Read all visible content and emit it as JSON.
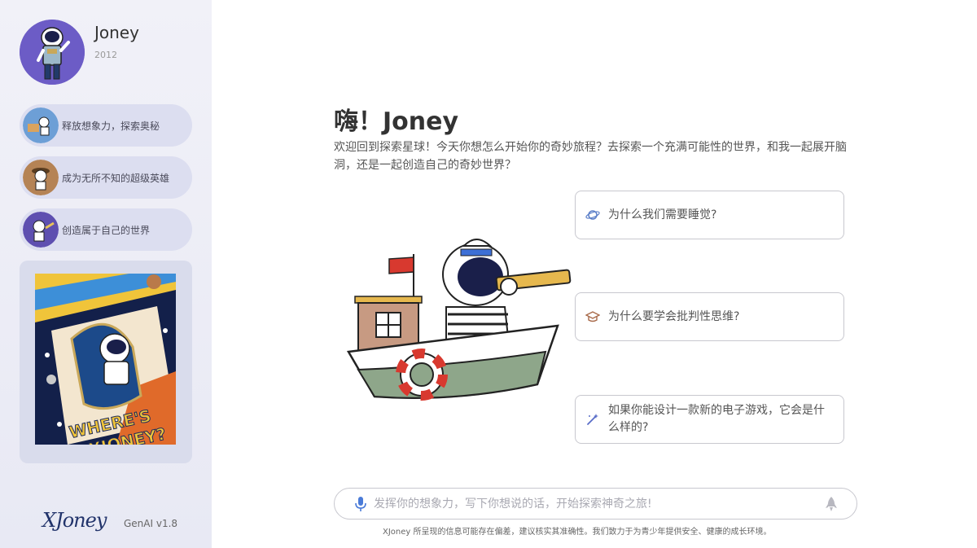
{
  "sidebar": {
    "profile": {
      "name": "Joney",
      "year": "2012"
    },
    "items": [
      {
        "label": "释放想象力，探索奥秘",
        "icon": "astronaut-painting-thumb"
      },
      {
        "label": "成为无所不知的超级英雄",
        "icon": "astronaut-explorer-thumb"
      },
      {
        "label": "创造属于自己的世界",
        "icon": "astronaut-creator-thumb"
      }
    ],
    "poster": {
      "text_line1": "WHERE'S",
      "text_line2": "XJONEY?"
    },
    "brand": "XJoney",
    "version": "GenAI v1.8"
  },
  "main": {
    "greeting": "嗨！Joney",
    "welcome": "欢迎回到探索星球！今天你想怎么开始你的奇妙旅程？去探索一个充满可能性的世界，和我一起展开脑洞，还是一起创造自己的奇妙世界？",
    "prompts": [
      {
        "text": "为什么我们需要睡觉?",
        "icon": "planet-icon"
      },
      {
        "text": "为什么要学会批判性思维?",
        "icon": "graduation-cap-icon"
      },
      {
        "text": "如果你能设计一款新的电子游戏，它会是什么样的?",
        "icon": "magic-wand-icon"
      }
    ],
    "chat": {
      "placeholder": "发挥你的想象力，写下你想说的话，开始探索神奇之旅!"
    },
    "disclaimer": "XJoney 所呈现的信息可能存在偏差，建议核实其准确性。我们致力于为青少年提供安全、健康的成长环境。"
  },
  "colors": {
    "sidebar_bg": "#eeeff7",
    "sidebar_item_bg": "#dcdef0",
    "avatar_bg": "#6c5cc6",
    "brand": "#22346b",
    "card_border": "#c8c8cf",
    "mic": "#4a7bd8"
  }
}
